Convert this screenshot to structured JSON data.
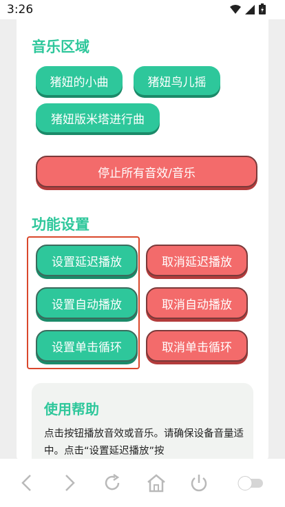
{
  "status": {
    "time": "3:26"
  },
  "music": {
    "title": "音乐区域",
    "songs": [
      "猪妞的小曲",
      "猪妞鸟儿摇",
      "猪妞版米塔进行曲"
    ],
    "stop_all": "停止所有音效/音乐"
  },
  "settings": {
    "title": "功能设置",
    "set_delay": "设置延迟播放",
    "cancel_delay": "取消延迟播放",
    "set_auto": "设置自动播放",
    "cancel_auto": "取消自动播放",
    "set_loop": "设置单击循环",
    "cancel_loop": "取消单击循环"
  },
  "help": {
    "title": "使用帮助",
    "text": "点击按钮播放音效或音乐。请确保设备音量适中。点击“设置延迟播放”按"
  },
  "colors": {
    "green": "#2ec79b",
    "red": "#f36b6b",
    "highlight": "#d9472b"
  }
}
